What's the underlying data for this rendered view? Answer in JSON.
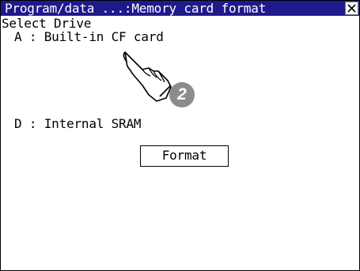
{
  "window": {
    "title": "Program/data ...:Memory card format",
    "close_icon": "close-icon",
    "title_bar_color": "#1f1a8c"
  },
  "main": {
    "select_drive_label": "Select Drive",
    "drives": [
      {
        "label": "A : Built-in CF card"
      },
      {
        "label": "D : Internal SRAM"
      }
    ],
    "format_button_label": "Format"
  },
  "annotation": {
    "step_number": "2",
    "pointer_icon": "pointing-hand-icon"
  }
}
